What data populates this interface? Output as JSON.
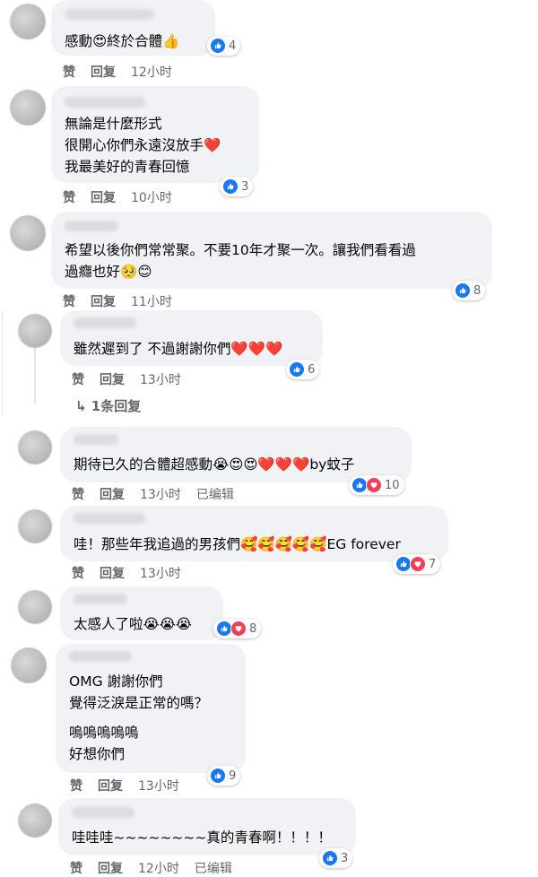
{
  "actions": {
    "like": "赞",
    "reply": "回复",
    "edited": "已编辑"
  },
  "comments": [
    {
      "lines": [
        "感動😍終於合體👍"
      ],
      "time": "12小时",
      "reactions": "4"
    },
    {
      "lines": [
        "無論是什麼形式",
        "很開心你們永遠沒放手❤️",
        "我最美好的青春回憶"
      ],
      "time": "10小时",
      "reactions": "3"
    },
    {
      "lines": [
        "希望以後你們常常聚。不要10年才聚一次。讓我們看看過",
        "過癮也好🥺😊"
      ],
      "time": "11小时",
      "reactions": "8"
    },
    {
      "lines": [
        "雖然遲到了 不過謝謝你們❤️❤️❤️"
      ],
      "time": "13小时",
      "reactions": "6",
      "replies": "1条回复"
    },
    {
      "lines": [
        "期待已久的合體超感動😭😍😍❤️❤️❤️by蚊子"
      ],
      "time": "13小时",
      "reactions": "10",
      "edited": true
    },
    {
      "lines": [
        "哇！那些年我追過的男孩們🥰🥰🥰🥰🥰EG forever"
      ],
      "time": "13小时",
      "reactions": "7"
    },
    {
      "lines": [
        "太感人了啦😭😭😭"
      ],
      "reactions": "8"
    },
    {
      "lines": [
        "OMG 謝謝你們",
        "覺得泛淚是正常的嗎？",
        "",
        "嗚嗚嗚嗚嗚",
        "好想你們"
      ],
      "time": "13小时",
      "reactions": "9"
    },
    {
      "lines": [
        "哇哇哇~~~~~~~~真的青春啊！！！！"
      ],
      "time": "12小时",
      "reactions": "3",
      "edited": true
    }
  ],
  "icons": {
    "like": "thumbs-up-icon",
    "love": "heart-icon",
    "reply_arrow": "reply-arrow-icon"
  },
  "colors": {
    "like": "#1877f2",
    "love": "#f33e58",
    "bubble": "#f0f2f5",
    "meta": "#65676b"
  }
}
